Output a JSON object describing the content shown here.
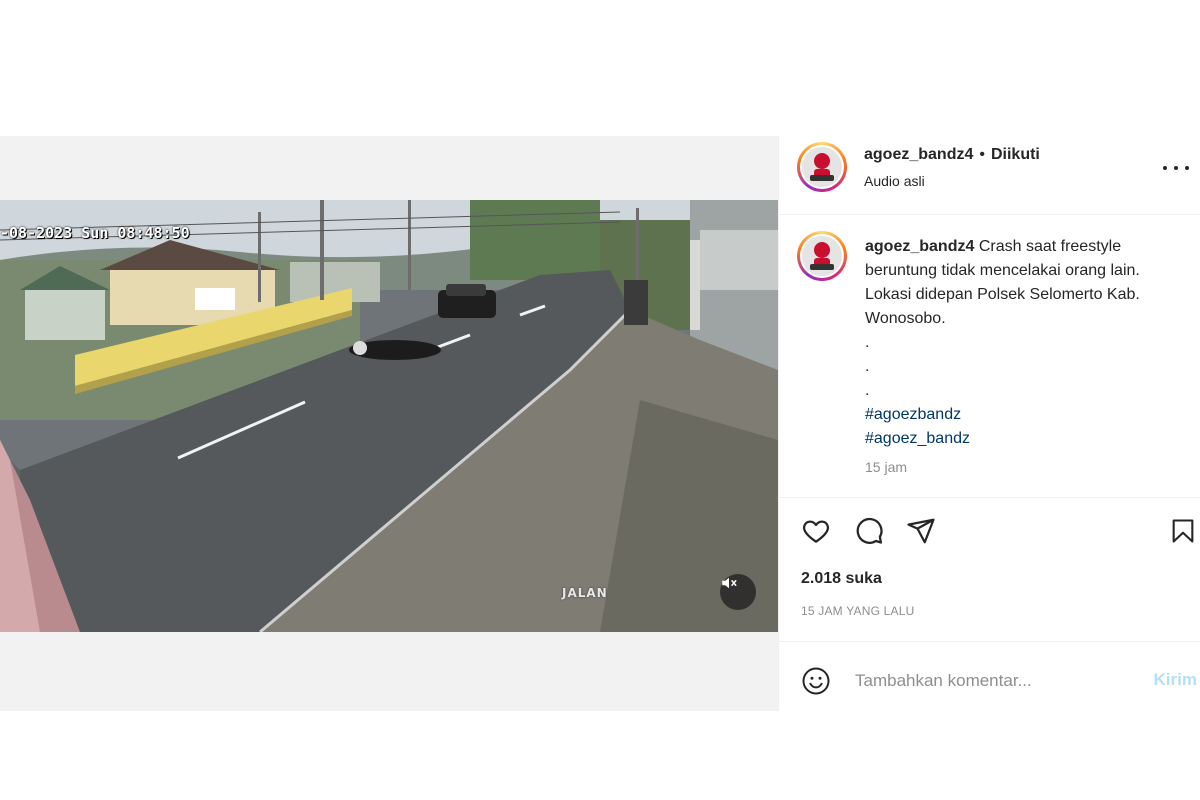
{
  "video": {
    "timestamp": "-08-2023 Sun 08:48:50",
    "watermark": "JALAN",
    "mute_icon": "speaker-muted-icon"
  },
  "header": {
    "username": "agoez_bandz4",
    "separator": "•",
    "follow_status": "Diikuti",
    "audio": "Audio asli",
    "more_icon": "more-options-icon"
  },
  "caption": {
    "username": "agoez_bandz4",
    "text": "Crash saat freestyle beruntung tidak mencelakai orang lain. Lokasi didepan Polsek Selomerto Kab. Wonosobo.",
    "dots": [
      ".",
      ".",
      "."
    ],
    "hashtags": [
      "#agoezbandz",
      "#agoez_bandz"
    ],
    "time": "15 jam"
  },
  "actions": {
    "like_icon": "heart-icon",
    "comment_icon": "comment-icon",
    "share_icon": "share-icon",
    "save_icon": "bookmark-icon"
  },
  "likes": "2.018 suka",
  "posted": "15 JAM YANG LALU",
  "comment": {
    "placeholder": "Tambahkan komentar...",
    "post_label": "Kirim",
    "emoji_icon": "emoji-icon"
  },
  "colors": {
    "link": "#00376b",
    "muted": "#8e8e8e",
    "post_button_disabled": "#b2dffc"
  }
}
